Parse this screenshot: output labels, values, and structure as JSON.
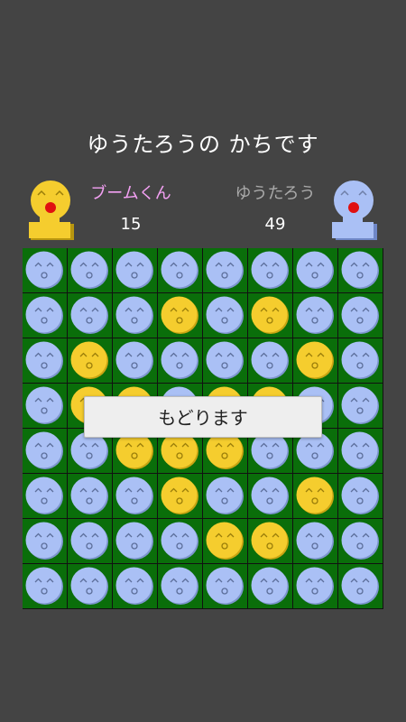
{
  "result_text": "ゆうたろうの かちです",
  "players": [
    {
      "name": "ブームくん",
      "score": "15",
      "icon": "yellow-character-icon",
      "color": "#f5cd2e"
    },
    {
      "name": "ゆうたろう",
      "score": "49",
      "icon": "blue-character-icon",
      "color": "#aac0f5"
    }
  ],
  "colors": {
    "board": "#0a6e0a",
    "yellow_piece": "#f5cd2e",
    "blue_piece": "#aac0f5",
    "background": "#444444"
  },
  "board": [
    "BBBBBBBB",
    "BBBYBYBB",
    "BYBBBBYB",
    "BYYBYYBB",
    "BBYYYBBB",
    "BBBYBBYB",
    "BBBBYYBB",
    "BBBBBBBB"
  ],
  "back_button_label": "もどります"
}
